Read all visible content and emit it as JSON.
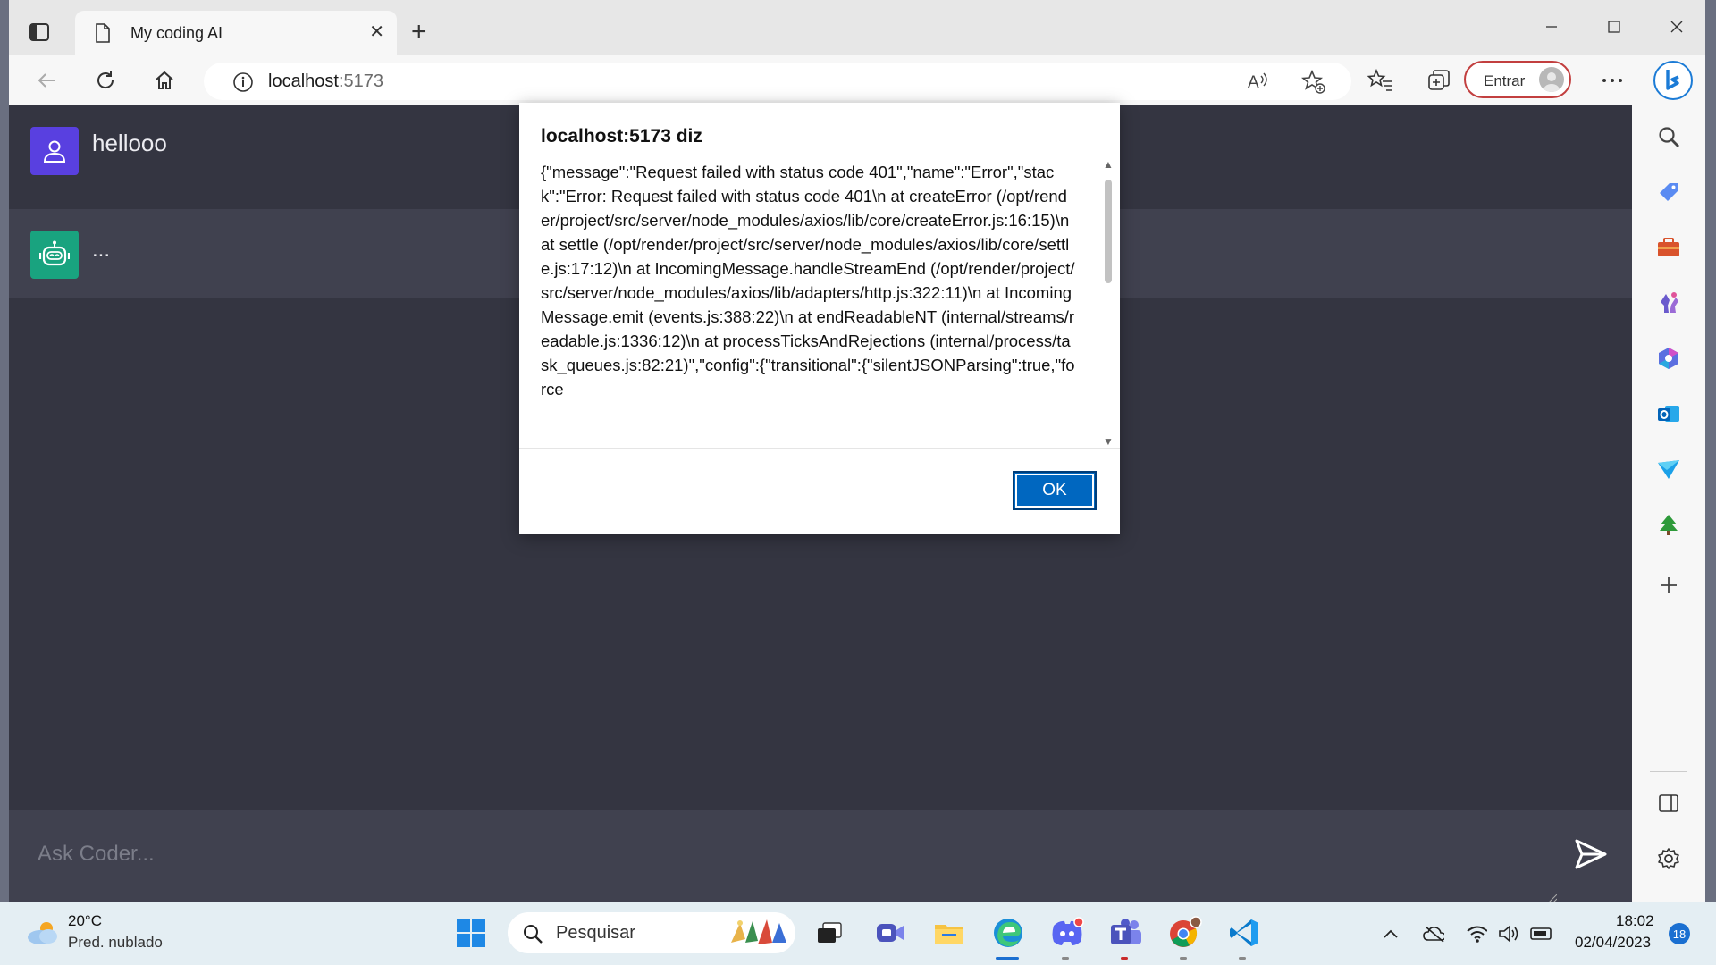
{
  "browser": {
    "tab_title": "My coding AI",
    "address_host": "localhost",
    "address_port": ":5173",
    "signin_label": "Entrar"
  },
  "chat": {
    "user_message": "hellooo",
    "bot_message": "...",
    "input_placeholder": "Ask Coder..."
  },
  "dialog": {
    "title": "localhost:5173 diz",
    "message": "{\"message\":\"Request failed with status code 401\",\"name\":\"Error\",\"stack\":\"Error: Request failed with status code 401\\n    at createError (/opt/render/project/src/server/node_modules/axios/lib/core/createError.js:16:15)\\n    at settle (/opt/render/project/src/server/node_modules/axios/lib/core/settle.js:17:12)\\n    at IncomingMessage.handleStreamEnd (/opt/render/project/src/server/node_modules/axios/lib/adapters/http.js:322:11)\\n    at IncomingMessage.emit (events.js:388:22)\\n    at endReadableNT (internal/streams/readable.js:1336:12)\\n    at processTicksAndRejections (internal/process/task_queues.js:82:21)\",\"config\":{\"transitional\":{\"silentJSONParsing\":true,\"force",
    "ok_label": "OK"
  },
  "taskbar": {
    "weather_temp": "20°C",
    "weather_desc": "Pred. nublado",
    "search_label": "Pesquisar",
    "time": "18:02",
    "date": "02/04/2023",
    "notification_count": "18"
  },
  "colors": {
    "user_avatar": "#5940e0",
    "bot_avatar": "#19a37f",
    "chat_bg": "#343541",
    "bot_row_bg": "#40414f",
    "ok_button": "#0067c0",
    "signin_border": "#c23f3f"
  }
}
